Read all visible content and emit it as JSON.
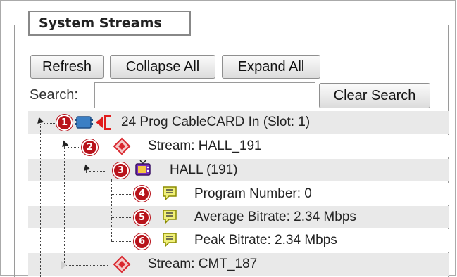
{
  "panel": {
    "legend": "System Streams"
  },
  "toolbar": {
    "refresh_label": "Refresh",
    "collapse_all_label": "Collapse All",
    "expand_all_label": "Expand All"
  },
  "search": {
    "label": "Search:",
    "value": "",
    "placeholder": "",
    "clear_label": "Clear Search"
  },
  "tree": {
    "nodes": [
      {
        "badge": "1",
        "icon": "cablecard-input-icon",
        "label": "24 Prog CableCARD In (Slot: 1)",
        "expanded": true
      },
      {
        "badge": "2",
        "icon": "stream-icon",
        "label": "Stream: HALL_191",
        "expanded": true
      },
      {
        "badge": "3",
        "icon": "tv-program-icon",
        "label": "HALL (191)",
        "expanded": true
      },
      {
        "badge": "4",
        "icon": "info-comment-icon",
        "label": "Program Number: 0"
      },
      {
        "badge": "5",
        "icon": "info-comment-icon",
        "label": "Average Bitrate: 2.34 Mbps"
      },
      {
        "badge": "6",
        "icon": "info-comment-icon",
        "label": "Peak Bitrate: 2.34 Mbps"
      },
      {
        "badge": "",
        "icon": "stream-icon",
        "label": "Stream: CMT_187",
        "expanded": false
      }
    ]
  },
  "colors": {
    "badge": "#b8131b",
    "row_alt": "#e9e9e9",
    "info_icon": "#c8c800",
    "stream_icon": "#d9272e",
    "tv_icon": "#7b2fbf"
  }
}
